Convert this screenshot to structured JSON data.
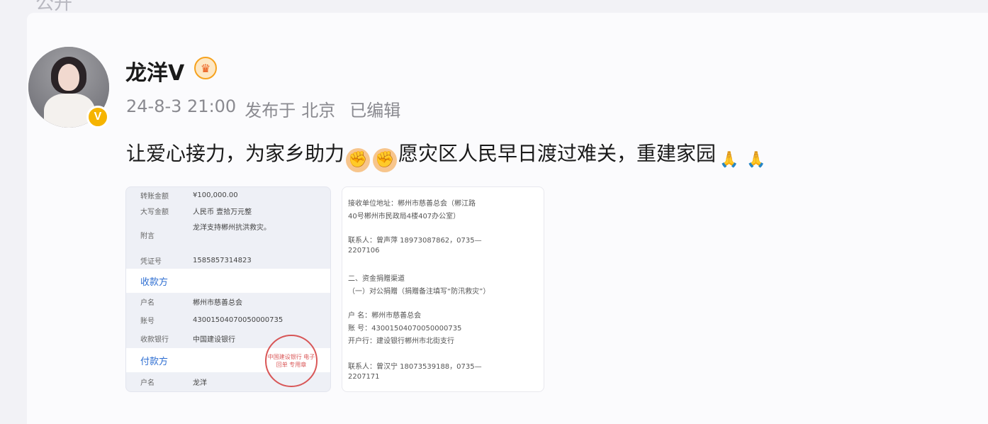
{
  "top_cut_text": "公开",
  "user": {
    "name": "龙洋V",
    "verified_badge": "V",
    "crown_icon": "crown-icon"
  },
  "meta": {
    "date": "24-8-3 21:00",
    "publish": "发布于",
    "location": "北京",
    "edited": "已编辑"
  },
  "post": {
    "text_a": "让爱心接力，为家乡助力",
    "text_b": "愿灾区人民早日渡过难关，重建家园"
  },
  "receipt": {
    "rows_top": [
      {
        "k": "转账金额",
        "v": "¥100,000.00"
      },
      {
        "k": "大写金额",
        "v": "人民币 壹拾万元整"
      },
      {
        "k": "附言",
        "v": "龙洋支持郴州抗洪救灾。"
      },
      {
        "k": "凭证号",
        "v": "1585857314823"
      }
    ],
    "receiver_label": "收款方",
    "rows_mid": [
      {
        "k": "户名",
        "v": "郴州市慈善总会"
      },
      {
        "k": "账号",
        "v": "43001504070050000735"
      },
      {
        "k": "收款银行",
        "v": "中国建设银行"
      }
    ],
    "payer_label": "付款方",
    "rows_bottom": [
      {
        "k": "户名",
        "v": "龙洋"
      }
    ],
    "stamp_text": "中国建设银行 电子回单 专用章"
  },
  "notice": {
    "lines": [
      "接收单位地址：郴州市慈善总会（郴江路",
      "40号郴州市民政局4楼407办公室）",
      "联系人：曾声萍 18973087862，0735—",
      "2207106",
      "二、资金捐赠渠道",
      "（一）对公捐赠（捐赠备注填写“防汛救灾”）",
      "户  名：郴州市慈善总会",
      "账  号：43001504070050000735",
      "开户行：建设银行郴州市北街支行",
      "联系人：曾汉宁 18073539188，0735—",
      "2207171"
    ]
  }
}
